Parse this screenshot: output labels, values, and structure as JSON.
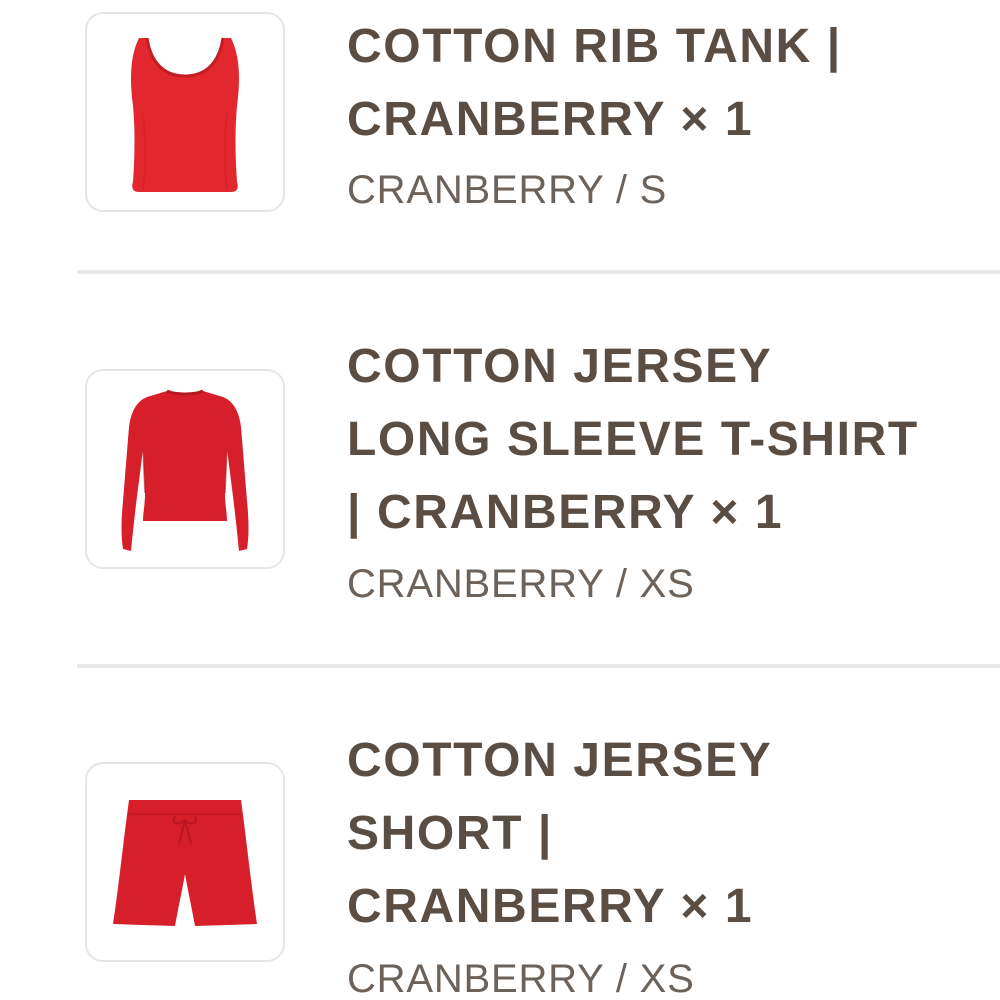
{
  "colors": {
    "title_text": "#5a4e44",
    "variant_text": "#6c6259",
    "product_red": "#e3272e",
    "thumb_border": "#e6e6e6",
    "divider": "#e8e8e8"
  },
  "cart_items": [
    {
      "title": "COTTON RIB TANK |\nCRANBERRY × 1",
      "variant": "CRANBERRY / S",
      "image_icon": "tank-top-image"
    },
    {
      "title": "COTTON JERSEY\nLONG SLEEVE T-SHIRT\n| CRANBERRY × 1",
      "variant": "CRANBERRY / XS",
      "image_icon": "long-sleeve-shirt-image"
    },
    {
      "title": "COTTON JERSEY\nSHORT |\nCRANBERRY × 1",
      "variant": "CRANBERRY / XS",
      "image_icon": "shorts-image"
    }
  ]
}
